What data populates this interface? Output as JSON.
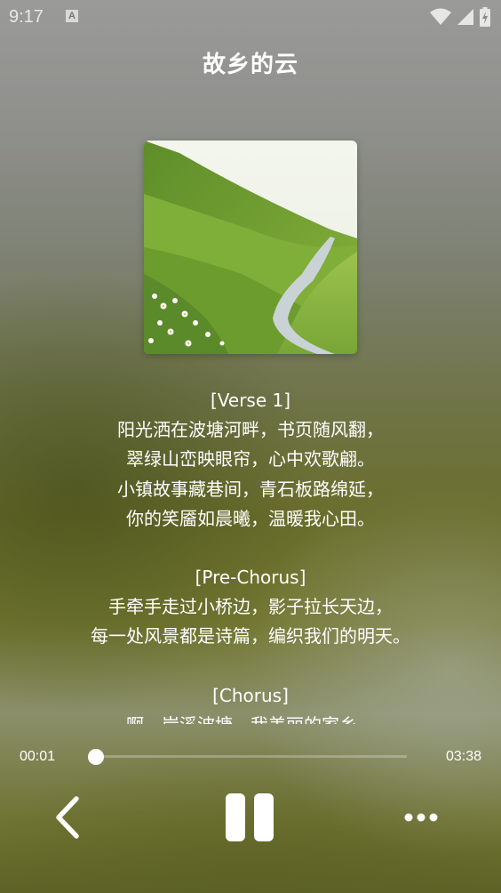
{
  "status_bar": {
    "time": "9:17",
    "notification_icon": "a-notification-icon"
  },
  "song": {
    "title": "故乡的云"
  },
  "lyrics": [
    "[Verse 1]",
    "阳光洒在波塘河畔，书页随风翻，",
    "翠绿山峦映眼帘，心中欢歌翩。",
    "小镇故事藏巷间，青石板路绵延，",
    "你的笑靥如晨曦，温暖我心田。",
    "",
    "[Pre-Chorus]",
    "手牵手走过小桥边，影子拉长天边，",
    "每一处风景都是诗篇，编织我们的明天。",
    "",
    "[Chorus]",
    "啊，岸溪波塘，我美丽的家乡，"
  ],
  "player": {
    "current_time": "00:01",
    "total_time": "03:38",
    "progress_fraction": 0.005
  },
  "controls": {
    "back_icon": "chevron-left-icon",
    "pause_icon": "pause-icon",
    "more_icon": "more-horizontal-icon"
  }
}
